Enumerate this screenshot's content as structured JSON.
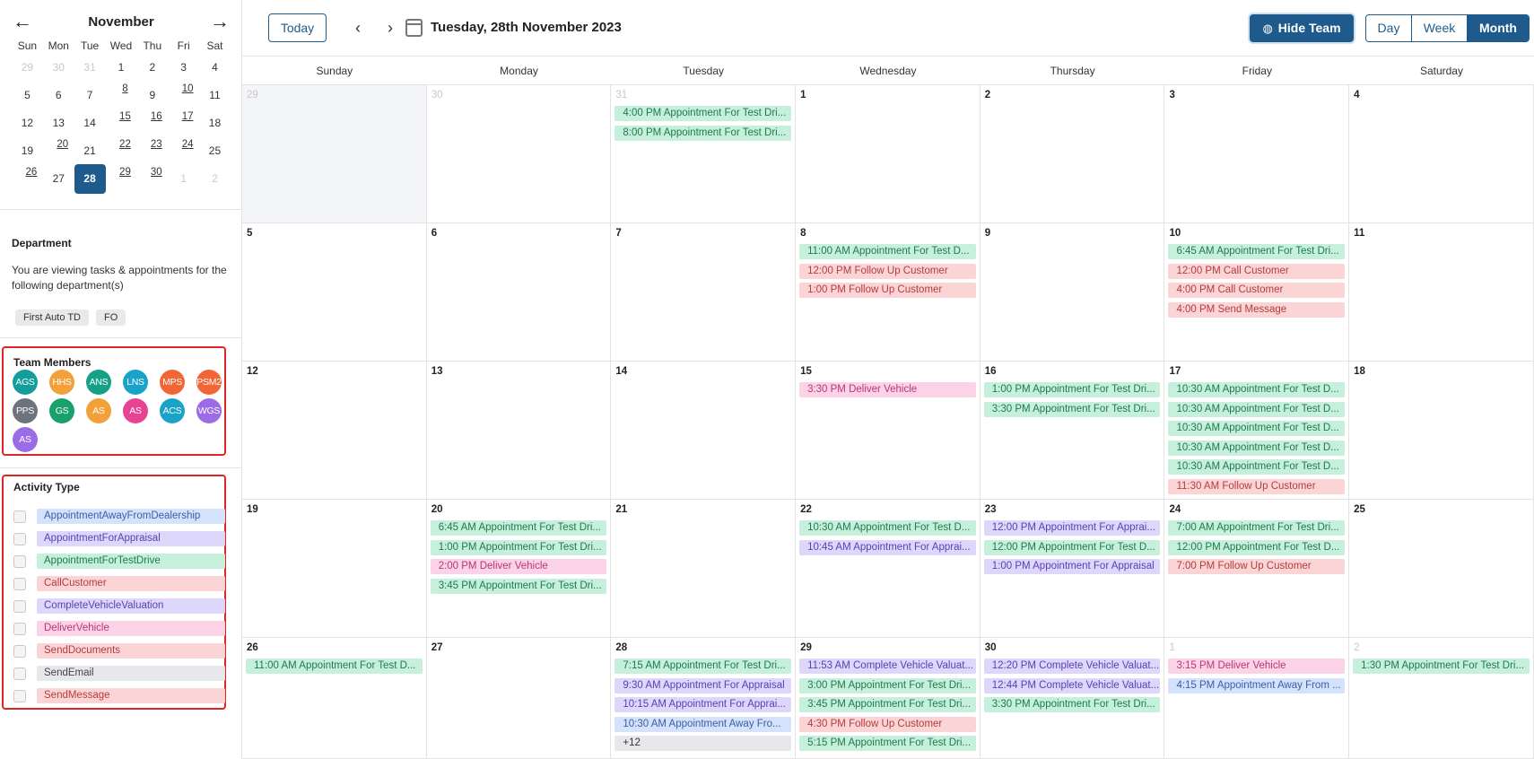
{
  "colors": {
    "primary": "#1e5b8c",
    "test_drive_bg": "#c7f0dc",
    "test_drive_fg": "#1e7a50",
    "appraisal_bg": "#ddd7fb",
    "appraisal_fg": "#5b3fb3",
    "away_bg": "#d4e2fb",
    "away_fg": "#3b5ea8",
    "call_bg": "#fbd5d6",
    "call_fg": "#b43c3c",
    "deliver_bg": "#fbd2e6",
    "deliver_fg": "#b8367a",
    "email_bg": "#e6e8ec",
    "email_fg": "#444"
  },
  "mini_calendar": {
    "month": "November",
    "prev_icon": "arrow-left-icon",
    "next_icon": "arrow-right-icon",
    "weekdays": [
      "Sun",
      "Mon",
      "Tue",
      "Wed",
      "Thu",
      "Fri",
      "Sat"
    ],
    "days": [
      {
        "d": "29",
        "muted": true
      },
      {
        "d": "30",
        "muted": true
      },
      {
        "d": "31",
        "muted": true
      },
      {
        "d": "1"
      },
      {
        "d": "2"
      },
      {
        "d": "3"
      },
      {
        "d": "4"
      },
      {
        "d": "5"
      },
      {
        "d": "6"
      },
      {
        "d": "7"
      },
      {
        "d": "8",
        "ev": true
      },
      {
        "d": "9"
      },
      {
        "d": "10",
        "ev": true
      },
      {
        "d": "11"
      },
      {
        "d": "12"
      },
      {
        "d": "13"
      },
      {
        "d": "14"
      },
      {
        "d": "15",
        "ev": true
      },
      {
        "d": "16",
        "ev": true
      },
      {
        "d": "17",
        "ev": true
      },
      {
        "d": "18"
      },
      {
        "d": "19"
      },
      {
        "d": "20",
        "ev": true
      },
      {
        "d": "21"
      },
      {
        "d": "22",
        "ev": true
      },
      {
        "d": "23",
        "ev": true
      },
      {
        "d": "24",
        "ev": true
      },
      {
        "d": "25"
      },
      {
        "d": "26",
        "ev": true
      },
      {
        "d": "27"
      },
      {
        "d": "28",
        "sel": true
      },
      {
        "d": "29",
        "ev": true
      },
      {
        "d": "30",
        "ev": true
      },
      {
        "d": "1",
        "muted": true
      },
      {
        "d": "2",
        "muted": true
      }
    ]
  },
  "department": {
    "title": "Department",
    "description": "You are viewing tasks & appointments for the following department(s)",
    "chips": [
      "First Auto TD",
      "FO"
    ]
  },
  "team": {
    "title": "Team Members",
    "members": [
      {
        "initials": "AGS",
        "color": "#139e9b"
      },
      {
        "initials": "HHS",
        "color": "#f2a03a"
      },
      {
        "initials": "ANS",
        "color": "#16a085"
      },
      {
        "initials": "LNS",
        "color": "#1aa3c8"
      },
      {
        "initials": "MPS",
        "color": "#f26535"
      },
      {
        "initials": "PSM2",
        "color": "#f26535"
      },
      {
        "initials": "PPS",
        "color": "#6c737c"
      },
      {
        "initials": "GS",
        "color": "#1aa06b"
      },
      {
        "initials": "AS",
        "color": "#f2a03a"
      },
      {
        "initials": "AS",
        "color": "#e84393"
      },
      {
        "initials": "ACS",
        "color": "#1aa3c8"
      },
      {
        "initials": "WGS",
        "color": "#9b6ce6"
      },
      {
        "initials": "AS",
        "color": "#9b6ce6"
      }
    ]
  },
  "activity": {
    "title": "Activity Type",
    "items": [
      {
        "label": "AppointmentAwayFromDealership",
        "kind": "away"
      },
      {
        "label": "AppointmentForAppraisal",
        "kind": "appraisal"
      },
      {
        "label": "AppointmentForTestDrive",
        "kind": "test_drive"
      },
      {
        "label": "CallCustomer",
        "kind": "call"
      },
      {
        "label": "CompleteVehicleValuation",
        "kind": "appraisal"
      },
      {
        "label": "DeliverVehicle",
        "kind": "deliver"
      },
      {
        "label": "SendDocuments",
        "kind": "call"
      },
      {
        "label": "SendEmail",
        "kind": "email"
      },
      {
        "label": "SendMessage",
        "kind": "call"
      }
    ]
  },
  "toolbar": {
    "today_label": "Today",
    "prev_icon": "chevron-left-icon",
    "next_icon": "chevron-right-icon",
    "calendar_icon": "calendar-icon",
    "date_title": "Tuesday, 28th November 2023",
    "hide_team_label": "Hide Team",
    "hide_team_icon": "eye-off-icon",
    "views": [
      {
        "label": "Day",
        "active": false
      },
      {
        "label": "Week",
        "active": false
      },
      {
        "label": "Month",
        "active": true
      }
    ]
  },
  "month": {
    "weekdays": [
      "Sunday",
      "Monday",
      "Tuesday",
      "Wednesday",
      "Thursday",
      "Friday",
      "Saturday"
    ],
    "cells": [
      {
        "d": "29",
        "muted": true,
        "shade": true,
        "events": []
      },
      {
        "d": "30",
        "muted": true,
        "events": []
      },
      {
        "d": "31",
        "muted": true,
        "events": [
          {
            "t": "4:00 PM Appointment For Test Dri...",
            "k": "test_drive"
          },
          {
            "t": "8:00 PM Appointment For Test Dri...",
            "k": "test_drive"
          }
        ]
      },
      {
        "d": "1",
        "events": []
      },
      {
        "d": "2",
        "events": []
      },
      {
        "d": "3",
        "events": []
      },
      {
        "d": "4",
        "events": []
      },
      {
        "d": "5",
        "events": []
      },
      {
        "d": "6",
        "events": []
      },
      {
        "d": "7",
        "events": []
      },
      {
        "d": "8",
        "events": [
          {
            "t": "11:00 AM Appointment For Test D...",
            "k": "test_drive"
          },
          {
            "t": "12:00 PM Follow Up Customer",
            "k": "call"
          },
          {
            "t": "1:00 PM Follow Up Customer",
            "k": "call"
          }
        ]
      },
      {
        "d": "9",
        "events": []
      },
      {
        "d": "10",
        "events": [
          {
            "t": "6:45 AM Appointment For Test Dri...",
            "k": "test_drive"
          },
          {
            "t": "12:00 PM Call Customer",
            "k": "call"
          },
          {
            "t": "4:00 PM Call Customer",
            "k": "call"
          },
          {
            "t": "4:00 PM Send Message",
            "k": "call"
          }
        ]
      },
      {
        "d": "11",
        "events": []
      },
      {
        "d": "12",
        "events": []
      },
      {
        "d": "13",
        "events": []
      },
      {
        "d": "14",
        "events": []
      },
      {
        "d": "15",
        "events": [
          {
            "t": "3:30 PM Deliver Vehicle",
            "k": "deliver"
          }
        ]
      },
      {
        "d": "16",
        "events": [
          {
            "t": "1:00 PM Appointment For Test Dri...",
            "k": "test_drive"
          },
          {
            "t": "3:30 PM Appointment For Test Dri...",
            "k": "test_drive"
          }
        ]
      },
      {
        "d": "17",
        "events": [
          {
            "t": "10:30 AM Appointment For Test D...",
            "k": "test_drive"
          },
          {
            "t": "10:30 AM Appointment For Test D...",
            "k": "test_drive"
          },
          {
            "t": "10:30 AM Appointment For Test D...",
            "k": "test_drive"
          },
          {
            "t": "10:30 AM Appointment For Test D...",
            "k": "test_drive"
          },
          {
            "t": "10:30 AM Appointment For Test D...",
            "k": "test_drive"
          },
          {
            "t": "11:30 AM Follow Up Customer",
            "k": "call"
          }
        ]
      },
      {
        "d": "18",
        "events": []
      },
      {
        "d": "19",
        "events": []
      },
      {
        "d": "20",
        "events": [
          {
            "t": "6:45 AM Appointment For Test Dri...",
            "k": "test_drive"
          },
          {
            "t": "1:00 PM Appointment For Test Dri...",
            "k": "test_drive"
          },
          {
            "t": "2:00 PM Deliver Vehicle",
            "k": "deliver"
          },
          {
            "t": "3:45 PM Appointment For Test Dri...",
            "k": "test_drive"
          }
        ]
      },
      {
        "d": "21",
        "events": []
      },
      {
        "d": "22",
        "events": [
          {
            "t": "10:30 AM Appointment For Test D...",
            "k": "test_drive"
          },
          {
            "t": "10:45 AM Appointment For Apprai...",
            "k": "appraisal"
          }
        ]
      },
      {
        "d": "23",
        "events": [
          {
            "t": "12:00 PM Appointment For Apprai...",
            "k": "appraisal"
          },
          {
            "t": "12:00 PM Appointment For Test D...",
            "k": "test_drive"
          },
          {
            "t": "1:00 PM Appointment For Appraisal",
            "k": "appraisal"
          }
        ]
      },
      {
        "d": "24",
        "events": [
          {
            "t": "7:00 AM Appointment For Test Dri...",
            "k": "test_drive"
          },
          {
            "t": "12:00 PM Appointment For Test D...",
            "k": "test_drive"
          },
          {
            "t": "7:00 PM Follow Up Customer",
            "k": "call"
          }
        ]
      },
      {
        "d": "25",
        "events": []
      },
      {
        "d": "26",
        "events": [
          {
            "t": "11:00 AM Appointment For Test D...",
            "k": "test_drive"
          }
        ]
      },
      {
        "d": "27",
        "events": []
      },
      {
        "d": "28",
        "events": [
          {
            "t": "7:15 AM Appointment For Test Dri...",
            "k": "test_drive"
          },
          {
            "t": "9:30 AM Appointment For Appraisal",
            "k": "appraisal"
          },
          {
            "t": "10:15 AM Appointment For Apprai...",
            "k": "appraisal"
          },
          {
            "t": "10:30 AM Appointment Away Fro...",
            "k": "away"
          },
          {
            "t": "+12",
            "k": "more"
          }
        ]
      },
      {
        "d": "29",
        "events": [
          {
            "t": "11:53 AM Complete Vehicle Valuat...",
            "k": "appraisal"
          },
          {
            "t": "3:00 PM Appointment For Test Dri...",
            "k": "test_drive"
          },
          {
            "t": "3:45 PM Appointment For Test Dri...",
            "k": "test_drive"
          },
          {
            "t": "4:30 PM Follow Up Customer",
            "k": "call"
          },
          {
            "t": "5:15 PM Appointment For Test Dri...",
            "k": "test_drive"
          }
        ]
      },
      {
        "d": "30",
        "events": [
          {
            "t": "12:20 PM Complete Vehicle Valuat...",
            "k": "appraisal"
          },
          {
            "t": "12:44 PM Complete Vehicle Valuat...",
            "k": "appraisal"
          },
          {
            "t": "3:30 PM Appointment For Test Dri...",
            "k": "test_drive"
          }
        ]
      },
      {
        "d": "1",
        "muted": true,
        "events": [
          {
            "t": "3:15 PM Deliver Vehicle",
            "k": "deliver"
          },
          {
            "t": "4:15 PM Appointment Away From ...",
            "k": "away"
          }
        ]
      },
      {
        "d": "2",
        "muted": true,
        "events": [
          {
            "t": "1:30 PM Appointment For Test Dri...",
            "k": "test_drive"
          }
        ]
      }
    ]
  }
}
